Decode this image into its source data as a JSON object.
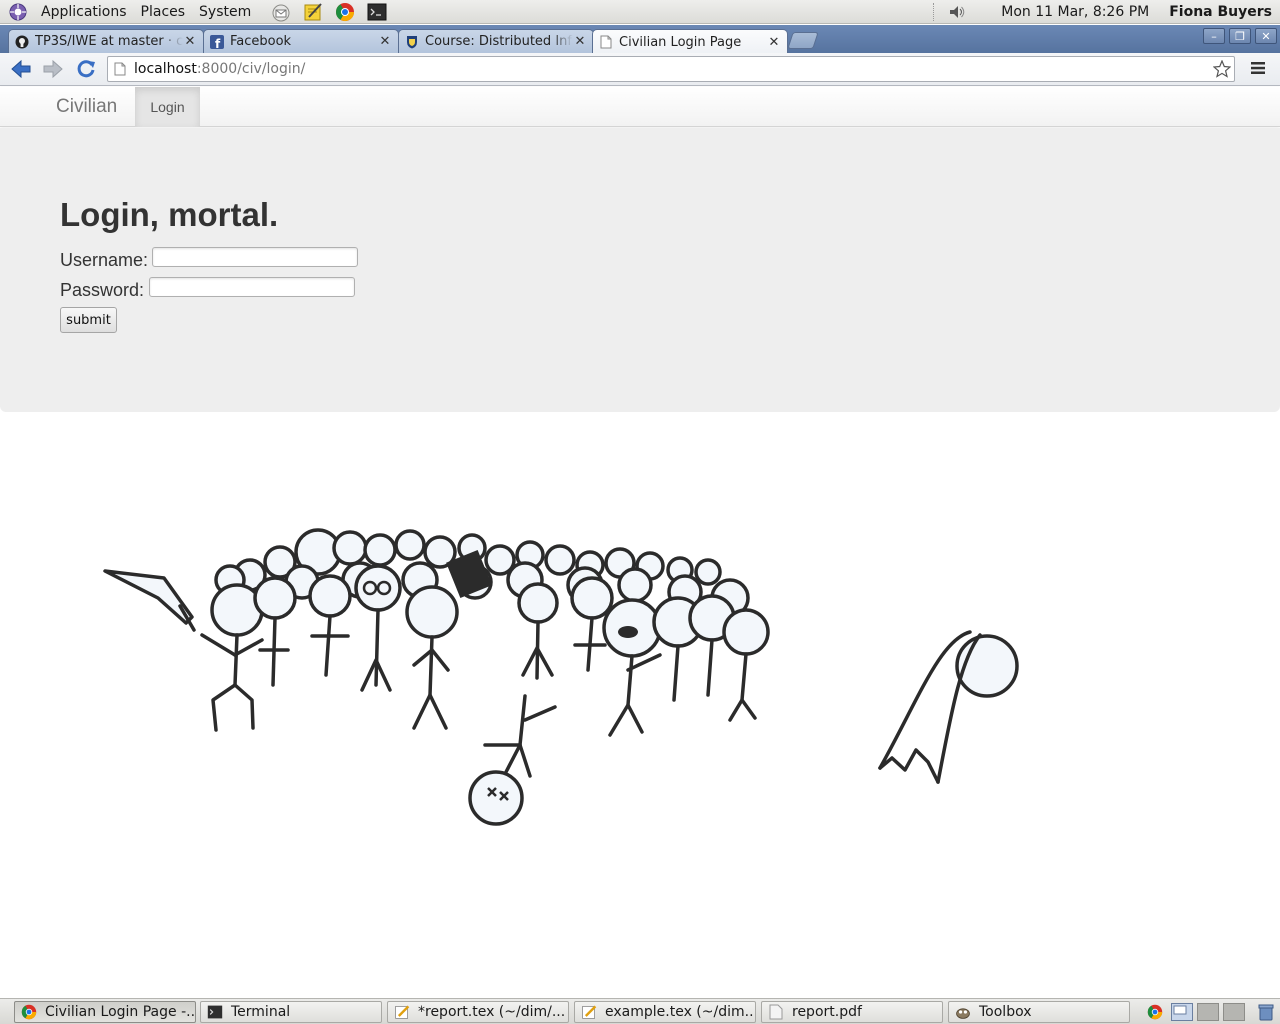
{
  "top_panel": {
    "menus": [
      "Applications",
      "Places",
      "System"
    ],
    "clock": "Mon 11 Mar,  8:26 PM",
    "user": "Fiona Buyers"
  },
  "browser": {
    "tabs": [
      {
        "title": "TP3S/IWE at master · c",
        "icon": "github-icon",
        "active": false
      },
      {
        "title": "Facebook",
        "icon": "facebook-icon",
        "active": false
      },
      {
        "title": "Course: Distributed Info",
        "icon": "shield-icon",
        "active": false
      },
      {
        "title": "Civilian Login Page",
        "icon": "page-icon",
        "active": true
      }
    ],
    "url_host": "localhost",
    "url_path": ":8000/civ/login/"
  },
  "page": {
    "brand": "Civilian",
    "nav_active": "Login",
    "title": "Login, mortal.",
    "username_label": "Username:",
    "username_value": "",
    "password_label": "Password:",
    "password_value": "",
    "submit_label": "submit"
  },
  "taskbar": {
    "items": [
      {
        "label": "Civilian Login Page -...",
        "icon": "chrome-icon",
        "active": true
      },
      {
        "label": "Terminal",
        "icon": "terminal-icon",
        "active": false
      },
      {
        "label": "*report.tex (~/dim/...",
        "icon": "text-editor-icon",
        "active": false
      },
      {
        "label": "example.tex (~/dim...",
        "icon": "text-editor-icon",
        "active": false
      },
      {
        "label": "report.pdf",
        "icon": "document-icon",
        "active": false
      },
      {
        "label": "Toolbox",
        "icon": "gimp-icon",
        "active": false
      }
    ]
  }
}
